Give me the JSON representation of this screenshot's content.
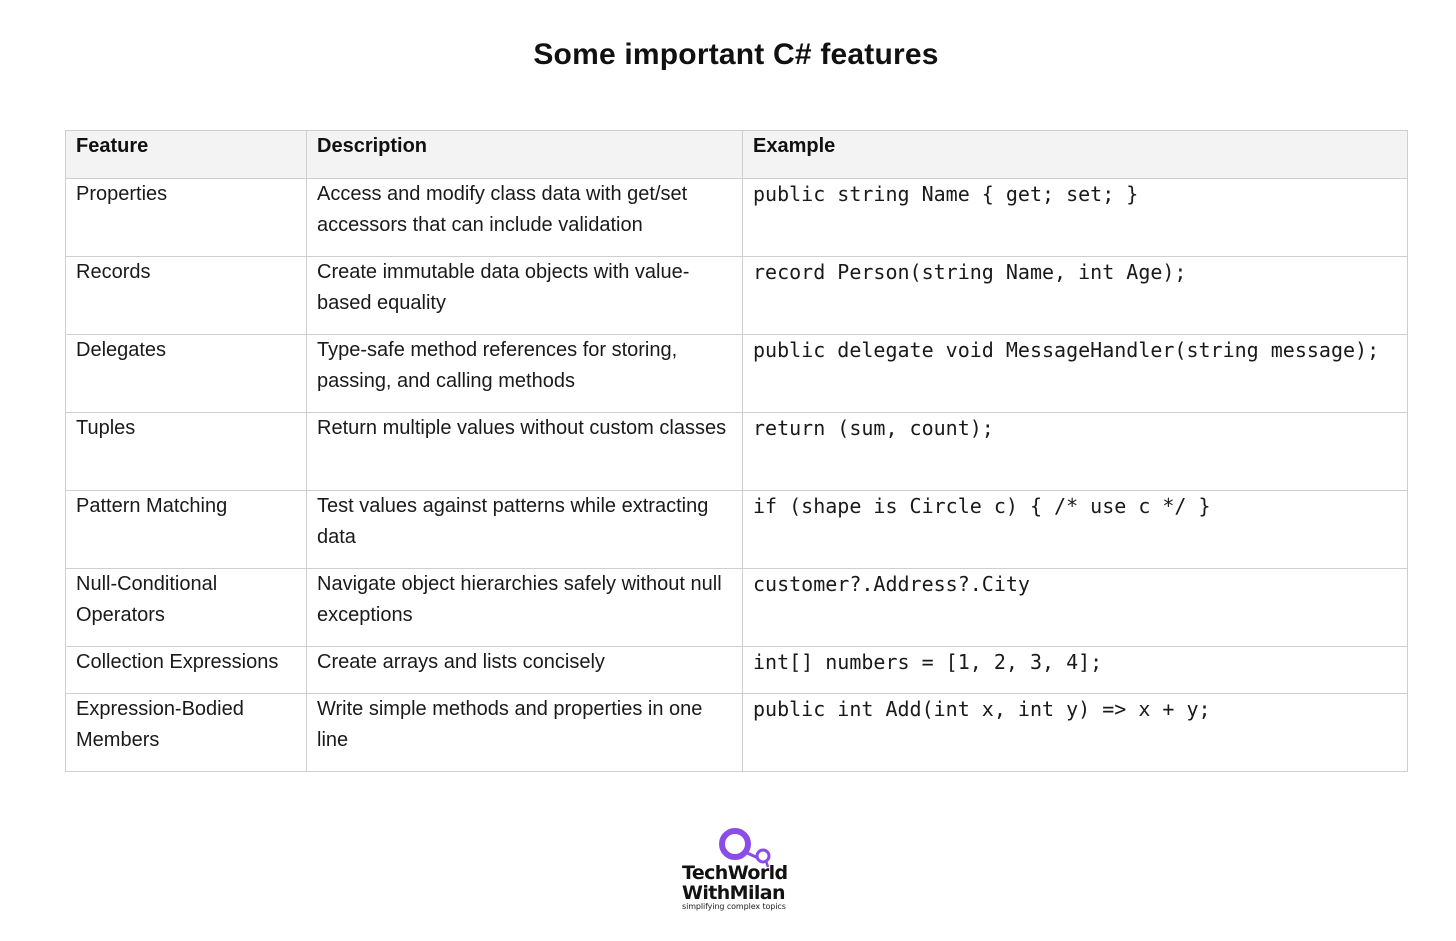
{
  "title": "Some important C# features",
  "colors": {
    "header_bg": "#f3f3f3",
    "border": "#cfcfcf",
    "logo_purple": "#8a4de8"
  },
  "table": {
    "headers": [
      "Feature",
      "Description",
      "Example"
    ],
    "rows": [
      {
        "feature": "Properties",
        "description": "Access and modify class data with get/set accessors that can include validation",
        "example": "public string Name { get; set; }"
      },
      {
        "feature": "Records",
        "description": "Create immutable data objects with value-based equality",
        "example": "record Person(string Name, int Age);"
      },
      {
        "feature": "Delegates",
        "description": "Type-safe method references for storing, passing, and calling methods",
        "example": "public delegate void MessageHandler(string message);"
      },
      {
        "feature": "Tuples",
        "description": "Return multiple values without custom classes",
        "example": "return (sum, count);"
      },
      {
        "feature": "Pattern Matching",
        "description": "Test values against patterns while extracting data",
        "example": "if (shape is Circle c) { /* use c */ }"
      },
      {
        "feature": "Null-Conditional Operators",
        "description": "Navigate object hierarchies safely without null exceptions",
        "example": "customer?.Address?.City"
      },
      {
        "feature": "Collection Expressions",
        "description": "Create arrays and lists concisely",
        "example": "int[] numbers = [1, 2, 3, 4];"
      },
      {
        "feature": "Expression-Bodied Members",
        "description": "Write simple methods and properties in one line",
        "example": "public int Add(int x, int y) => x + y;"
      }
    ]
  },
  "logo": {
    "line1": "TechWorld",
    "line2": "WithMilan",
    "tagline": "simplifying complex topics"
  }
}
